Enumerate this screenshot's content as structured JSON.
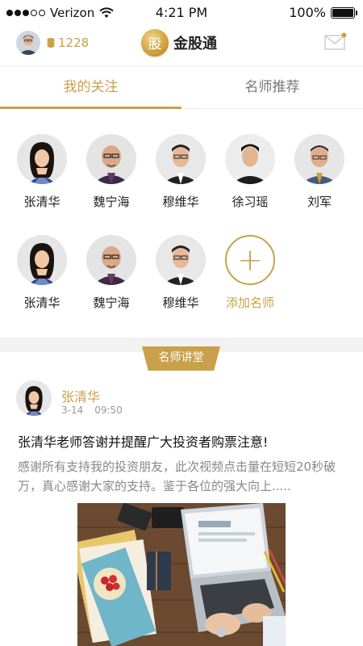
{
  "status_bar": {
    "carrier": "Verizon",
    "time": "4:21 PM",
    "battery": "100%"
  },
  "header": {
    "coins": "1228",
    "app_name": "金股通",
    "logo_glyph": "股"
  },
  "tabs": [
    {
      "label": "我的关注",
      "active": true
    },
    {
      "label": "名师推荐",
      "active": false
    }
  ],
  "teachers": [
    {
      "name": "张清华",
      "avatar": "woman"
    },
    {
      "name": "魏宁海",
      "avatar": "bald-man"
    },
    {
      "name": "穆维华",
      "avatar": "man-glasses"
    },
    {
      "name": "徐习瑶",
      "avatar": "young-man"
    },
    {
      "name": "刘军",
      "avatar": "older-man"
    },
    {
      "name": "张清华",
      "avatar": "woman"
    },
    {
      "name": "魏宁海",
      "avatar": "bald-man"
    },
    {
      "name": "穆维华",
      "avatar": "man-glasses"
    }
  ],
  "add_teacher_label": "添加名师",
  "section_title": "名师讲堂",
  "post": {
    "author": "张清华",
    "date": "3-14",
    "time": "09:50",
    "title": "张清华老师答谢并提醒广大投资者购票注意!",
    "excerpt": "感谢所有支持我的投资朋友，此次视频点击量在短短20秒破万，真心感谢大家的支持。鉴于各位的强大向上....."
  },
  "colors": {
    "accent": "#c9a14a",
    "divider": "#f2f2f2"
  }
}
